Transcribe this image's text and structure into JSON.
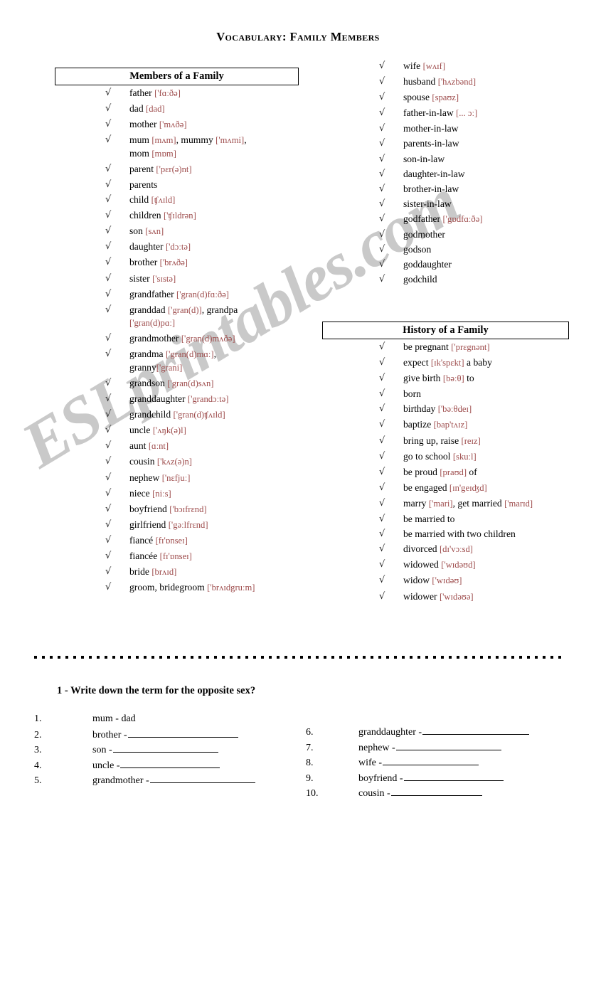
{
  "document": {
    "title": "Vocabulary: Family Members"
  },
  "watermark": {
    "text": "ESLprintables.com",
    "color": "#c9c9c9"
  },
  "colors": {
    "ipa": "#9d4b4b",
    "text": "#000000",
    "border": "#000000"
  },
  "icons": {
    "tick": "√"
  },
  "sections": {
    "members": {
      "heading": "Members of a Family",
      "items_left": [
        {
          "term": "father ",
          "ipa": "['fɑːðə]"
        },
        {
          "term": "dad ",
          "ipa": "[dad]"
        },
        {
          "term": "mother ",
          "ipa": "['mʌðə]"
        },
        {
          "term": "mum ",
          "ipa": "[mʌm]",
          "term2": ", mummy ",
          "ipa2": "['mʌmi]",
          "term3": ",",
          "line2_term": "mom ",
          "line2_ipa": "[mɒm]"
        },
        {
          "term": "parent ",
          "ipa": "['pɛr(ə)nt]"
        },
        {
          "term": "parents",
          "ipa": ""
        },
        {
          "term": "child ",
          "ipa": "[ʧʌɪld]"
        },
        {
          "term": "children ",
          "ipa": "['ʧɪldrən]"
        },
        {
          "term": "son ",
          "ipa": "[sʌn]"
        },
        {
          "term": "daughter ",
          "ipa": "['dɔːtə]"
        },
        {
          "term": "brother ",
          "ipa": "['brʌðə]"
        },
        {
          "term": "sister ",
          "ipa": "['sɪstə]"
        },
        {
          "term": "grandfather ",
          "ipa": "['gran(d)fɑːðə]"
        },
        {
          "term": "granddad ",
          "ipa": "['gran(d)]",
          "term2": ", grandpa",
          "line2_ipa": "['gran(d)pɑː]"
        },
        {
          "term": "grandmother ",
          "ipa": "['gran(d)mʌðə]"
        },
        {
          "term": "grandma ",
          "ipa": "['gran(d)mɑː]",
          "term3": ",",
          "line2_term": "granny",
          "line2_ipa": "['grani]"
        },
        {
          "term": "grandson ",
          "ipa": "['gran(d)sʌn]"
        },
        {
          "term": "granddaughter ",
          "ipa": "['grandɔːtə]"
        },
        {
          "term": "grandchild ",
          "ipa": "['gran(d)ʧʌɪld]"
        },
        {
          "term": "uncle ",
          "ipa": "['ʌŋk(ə)l]"
        },
        {
          "term": "aunt ",
          "ipa": "[ɑːnt]"
        },
        {
          "term": "cousin ",
          "ipa": "['kʌz(ə)n]"
        },
        {
          "term": "nephew ",
          "ipa": "['nɛfjuː]"
        },
        {
          "term": "niece ",
          "ipa": "[niːs]"
        },
        {
          "term": "boyfriend ",
          "ipa": "['bɔɪfrɛnd]"
        },
        {
          "term": "girlfriend ",
          "ipa": "['gəːlfrɛnd]"
        },
        {
          "term": "fiancé ",
          "ipa": "[fɪ'ɒnseɪ]"
        },
        {
          "term": "fiancée ",
          "ipa": "[fɪ'ɒnseɪ]"
        },
        {
          "term": "bride ",
          "ipa": "[brʌɪd]"
        },
        {
          "term": "groom, bridegroom ",
          "ipa": "['brʌɪdgruːm]"
        }
      ],
      "items_right": [
        {
          "term": "wife ",
          "ipa": "[wʌɪf]"
        },
        {
          "term": "husband ",
          "ipa": "['hʌzbənd]"
        },
        {
          "term": "spouse ",
          "ipa": "[spaʊz]"
        },
        {
          "term": "father-in-law ",
          "ipa": "[... ɔː]"
        },
        {
          "term": "mother-in-law",
          "ipa": ""
        },
        {
          "term": "parents-in-law",
          "ipa": ""
        },
        {
          "term": "son-in-law",
          "ipa": ""
        },
        {
          "term": "daughter-in-law",
          "ipa": ""
        },
        {
          "term": "brother-in-law",
          "ipa": ""
        },
        {
          "term": "sister-in-law",
          "ipa": ""
        },
        {
          "term": "godfather ",
          "ipa": "['gɒdfɑːðə]"
        },
        {
          "term": "godmother",
          "ipa": ""
        },
        {
          "term": "godson",
          "ipa": ""
        },
        {
          "term": "goddaughter",
          "ipa": ""
        },
        {
          "term": "godchild",
          "ipa": ""
        }
      ]
    },
    "history": {
      "heading": "History of a Family",
      "items": [
        {
          "term": "be pregnant ",
          "ipa": "['prɛgnənt]"
        },
        {
          "term": "expect ",
          "ipa": "[ɪk'spɛkt]",
          "term2": " a baby"
        },
        {
          "term": "give birth ",
          "ipa": "[bəːθ]",
          "term2": " to"
        },
        {
          "term": "born",
          "ipa": ""
        },
        {
          "term": "birthday ",
          "ipa": "['bəːθdeɪ]"
        },
        {
          "term": "baptize ",
          "ipa": "[bap'tʌɪz]"
        },
        {
          "term": "bring up, raise ",
          "ipa": "[reɪz]"
        },
        {
          "term": "go to school ",
          "ipa": "[skuːl]"
        },
        {
          "term": "be proud ",
          "ipa": "[praʊd]",
          "term2": " of"
        },
        {
          "term": "be engaged ",
          "ipa": "[ɪn'geɪʤd]"
        },
        {
          "term": "marry ",
          "ipa": "['mari]",
          "term2": ", get married ",
          "ipa2": "['marɪd]"
        },
        {
          "term": "be married to",
          "ipa": ""
        },
        {
          "term": "be married with two children",
          "ipa": ""
        },
        {
          "term": "divorced ",
          "ipa": "[dɪ'vɔːsd]"
        },
        {
          "term": "widowed ",
          "ipa": "['wɪdəʊd]"
        },
        {
          "term": "widow ",
          "ipa": "['wɪdəʊ]"
        },
        {
          "term": "widower ",
          "ipa": "['wɪdəʊə]"
        }
      ]
    }
  },
  "exercise": {
    "title": "1 - Write down the term for the opposite sex?",
    "left_items": [
      {
        "num": "1.",
        "word": "mum - dad",
        "blank_width": 0
      },
      {
        "num": "2.",
        "word": "brother -",
        "blank_width": 155
      },
      {
        "num": "3.",
        "word": "son -",
        "blank_width": 148
      },
      {
        "num": "4.",
        "word": "uncle -",
        "blank_width": 140
      },
      {
        "num": "5.",
        "word": "grandmother -",
        "blank_width": 148
      }
    ],
    "right_items": [
      {
        "num": "6.",
        "word": "granddaughter -",
        "blank_width": 150
      },
      {
        "num": "7.",
        "word": "nephew -",
        "blank_width": 148
      },
      {
        "num": "8.",
        "word": "wife -",
        "blank_width": 135
      },
      {
        "num": "9.",
        "word": "boyfriend -",
        "blank_width": 140
      },
      {
        "num": "10.",
        "word": "cousin -",
        "blank_width": 128
      }
    ]
  }
}
